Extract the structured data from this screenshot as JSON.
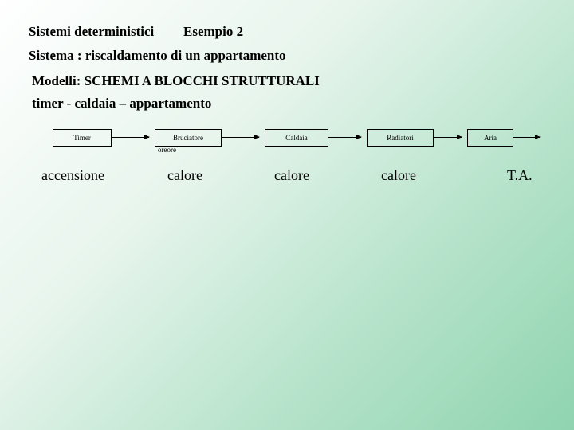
{
  "header": {
    "title_left": "Sistemi deterministici",
    "title_right": "Esempio 2",
    "subtitle": "Sistema : riscaldamento di un appartamento",
    "modelli": "Modelli: SCHEMI A BLOCCHI STRUTTURALI",
    "chain": "timer - caldaia – appartamento"
  },
  "blocks": {
    "b0": {
      "label": "Timer"
    },
    "b1": {
      "label": "Bruciatore",
      "sub": "oreore"
    },
    "b2": {
      "label": "Caldaia"
    },
    "b3": {
      "label": "Radiatori"
    },
    "b4": {
      "label": "Aria"
    }
  },
  "row_labels": {
    "l0": "accensione",
    "l1": "calore",
    "l2": "calore",
    "l3": "calore",
    "l4": "T.A."
  },
  "chart_data": {
    "type": "diagram",
    "nodes": [
      "Timer",
      "Bruciatore",
      "Caldaia",
      "Radiatori",
      "Aria"
    ],
    "edges": [
      {
        "from": "Timer",
        "to": "Bruciatore",
        "label": "accensione"
      },
      {
        "from": "Bruciatore",
        "to": "Caldaia",
        "label": "calore"
      },
      {
        "from": "Caldaia",
        "to": "Radiatori",
        "label": "calore"
      },
      {
        "from": "Radiatori",
        "to": "Aria",
        "label": "calore"
      }
    ],
    "output_label": "T.A.",
    "title": "Sistema : riscaldamento di un appartamento"
  }
}
